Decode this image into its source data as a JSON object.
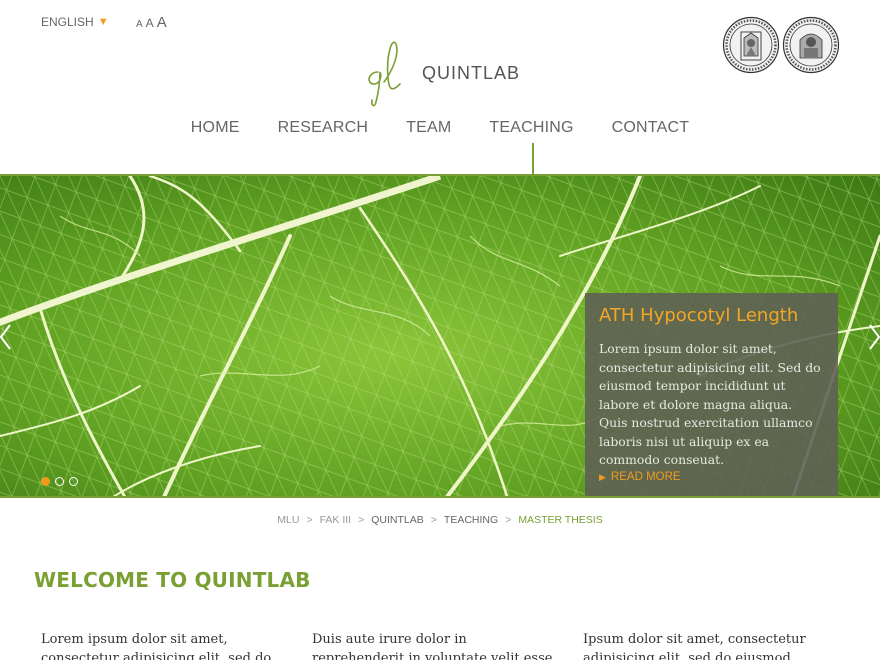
{
  "header": {
    "language": "ENGLISH",
    "font_sizes": [
      "A",
      "A",
      "A"
    ],
    "logo_text": "QUINTLAB",
    "accent_color": "#7aa033",
    "highlight_color": "#f29a1d"
  },
  "nav": {
    "items": [
      {
        "label": "HOME"
      },
      {
        "label": "RESEARCH"
      },
      {
        "label": "TEAM"
      },
      {
        "label": "TEACHING"
      },
      {
        "label": "CONTACT"
      }
    ],
    "active": "TEACHING"
  },
  "slider": {
    "title": "ATH Hypocotyl Length",
    "text": "Lorem ipsum dolor sit amet, consectetur adipisicing elit. Sed do eiusmod tempor incididunt ut labore et dolore magna aliqua. Quis nostrud exercitation ullamco laboris nisi ut aliquip ex ea commodo conseuat.",
    "read_more": "READ MORE",
    "slide_count": 3,
    "active_slide": 1
  },
  "breadcrumb": {
    "items": [
      "MLU",
      "FAK III",
      "QUINTLAB",
      "TEACHING",
      "MASTER THESIS"
    ],
    "separator": ">"
  },
  "main": {
    "title": "WELCOME TO QUINTLAB",
    "columns": [
      "Lorem ipsum dolor sit amet, consectetur adipisicing elit, sed do eiusmod tempor",
      "Duis aute irure dolor in reprehenderit in voluptate velit esse cillum dolore eu fugiat",
      "Ipsum dolor sit amet, consectetur adipisicing elit, sed do eiusmod tempor"
    ]
  }
}
